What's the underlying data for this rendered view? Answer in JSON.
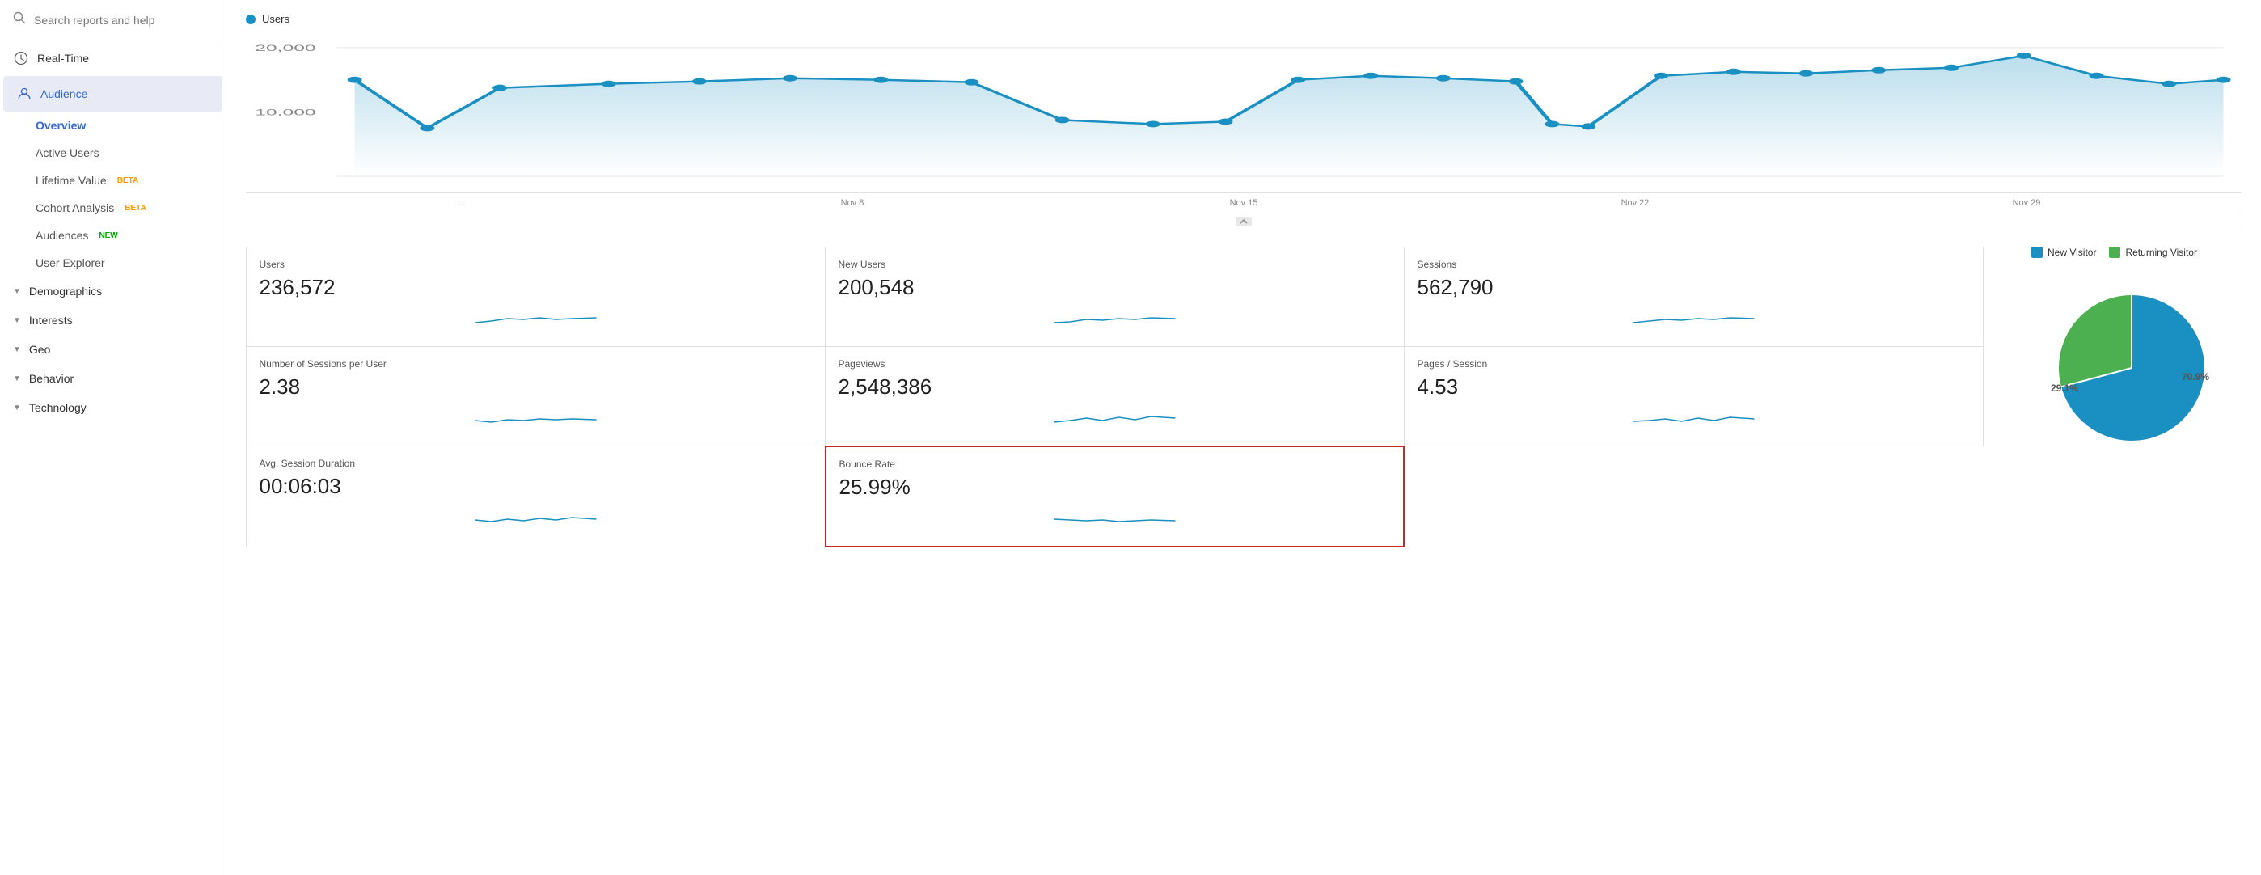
{
  "sidebar": {
    "search_placeholder": "Search reports and help",
    "nav": [
      {
        "id": "realtime",
        "label": "Real-Time",
        "icon": "clock"
      },
      {
        "id": "audience",
        "label": "Audience",
        "icon": "person",
        "active": true
      }
    ],
    "audience_sub": [
      {
        "id": "overview",
        "label": "Overview",
        "active": true
      },
      {
        "id": "active-users",
        "label": "Active Users"
      },
      {
        "id": "lifetime-value",
        "label": "Lifetime Value",
        "badge": "BETA",
        "badge_type": "beta"
      },
      {
        "id": "cohort-analysis",
        "label": "Cohort Analysis",
        "badge": "BETA",
        "badge_type": "beta"
      },
      {
        "id": "audiences",
        "label": "Audiences",
        "badge": "NEW",
        "badge_type": "new"
      },
      {
        "id": "user-explorer",
        "label": "User Explorer"
      }
    ],
    "expandable": [
      {
        "id": "demographics",
        "label": "Demographics"
      },
      {
        "id": "interests",
        "label": "Interests"
      },
      {
        "id": "geo",
        "label": "Geo"
      },
      {
        "id": "behavior",
        "label": "Behavior"
      },
      {
        "id": "technology",
        "label": "Technology"
      }
    ]
  },
  "chart": {
    "legend_label": "Users",
    "legend_color": "#1a8fc1",
    "y_labels": [
      "20,000",
      "10,000"
    ],
    "x_labels": [
      "...",
      "Nov 8",
      "Nov 15",
      "Nov 22",
      "Nov 29"
    ],
    "color": "#1a8fc1",
    "fill_color": "rgba(26,143,193,0.15)"
  },
  "metrics": [
    {
      "id": "users",
      "label": "Users",
      "value": "236,572",
      "highlighted": false
    },
    {
      "id": "new-users",
      "label": "New Users",
      "value": "200,548",
      "highlighted": false
    },
    {
      "id": "sessions",
      "label": "Sessions",
      "value": "562,790",
      "highlighted": false
    },
    {
      "id": "sessions-per-user",
      "label": "Number of Sessions per User",
      "value": "2.38",
      "highlighted": false
    },
    {
      "id": "pageviews",
      "label": "Pageviews",
      "value": "2,548,386",
      "highlighted": false
    },
    {
      "id": "pages-per-session",
      "label": "Pages / Session",
      "value": "4.53",
      "highlighted": false
    },
    {
      "id": "avg-session-duration",
      "label": "Avg. Session Duration",
      "value": "00:06:03",
      "highlighted": false
    },
    {
      "id": "bounce-rate",
      "label": "Bounce Rate",
      "value": "25.99%",
      "highlighted": true
    }
  ],
  "pie": {
    "new_visitor_label": "New Visitor",
    "returning_visitor_label": "Returning Visitor",
    "new_visitor_color": "#1a8fc1",
    "returning_visitor_color": "#4caf50",
    "new_visitor_pct": 70.9,
    "returning_visitor_pct": 29.1,
    "new_visitor_pct_label": "70.9%",
    "returning_visitor_pct_label": "29.1%"
  }
}
